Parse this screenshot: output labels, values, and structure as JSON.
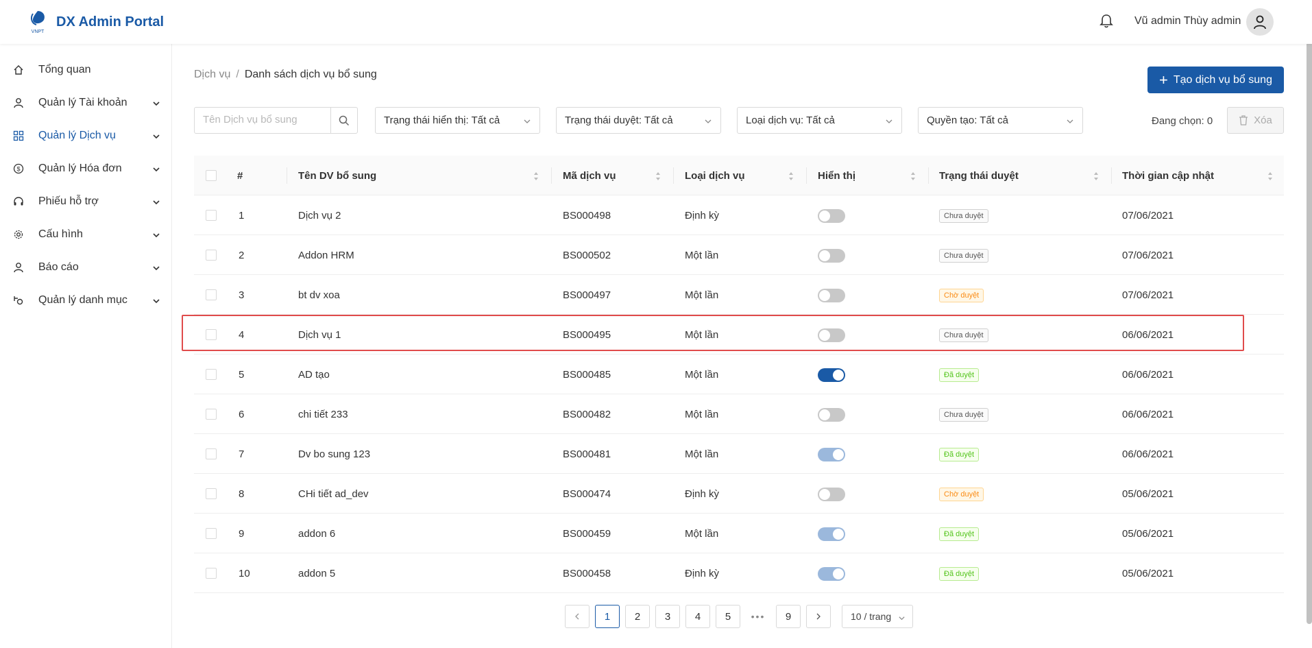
{
  "header": {
    "logo_text": "VNPT",
    "title": "DX Admin Portal",
    "username": "Vũ admin Thùy admin"
  },
  "sidebar": {
    "items": [
      {
        "label": "Tổng quan",
        "icon": "home-icon"
      },
      {
        "label": "Quản lý Tài khoản",
        "icon": "user-icon"
      },
      {
        "label": "Quản lý Dịch vụ",
        "icon": "grid-icon",
        "active": true
      },
      {
        "label": "Quản lý Hóa đơn",
        "icon": "dollar-icon"
      },
      {
        "label": "Phiếu hỗ trợ",
        "icon": "headset-icon"
      },
      {
        "label": "Cấu hình",
        "icon": "gear-icon"
      },
      {
        "label": "Báo cáo",
        "icon": "user-icon"
      },
      {
        "label": "Quản lý danh mục",
        "icon": "category-icon"
      }
    ]
  },
  "breadcrumb": {
    "parent": "Dịch vụ",
    "separator": "/",
    "current": "Danh sách dịch vụ bổ sung"
  },
  "toolbar": {
    "create_label": "Tạo dịch vụ bổ sung",
    "search_placeholder": "Tên Dịch vụ bổ sung",
    "filters": [
      "Trạng thái hiển thị: Tất cả",
      "Trạng thái duyệt: Tất cả",
      "Loại dịch vụ: Tất cả",
      "Quyền tạo: Tất cả"
    ],
    "selected_count": "Đang chọn: 0",
    "delete_label": "Xóa"
  },
  "table": {
    "columns": [
      "#",
      "Tên DV bổ sung",
      "Mã dịch vụ",
      "Loại dịch vụ",
      "Hiển thị",
      "Trạng thái duyệt",
      "Thời gian cập nhật"
    ],
    "rows": [
      {
        "no": "1",
        "name": "Dịch vụ 2",
        "code": "BS000498",
        "type": "Định kỳ",
        "display": "off",
        "status": "Chưa duyệt",
        "status_kind": "pending",
        "updated": "07/06/2021"
      },
      {
        "no": "2",
        "name": "Addon HRM",
        "code": "BS000502",
        "type": "Một lần",
        "display": "off",
        "status": "Chưa duyệt",
        "status_kind": "pending",
        "updated": "07/06/2021"
      },
      {
        "no": "3",
        "name": "bt dv xoa",
        "code": "BS000497",
        "type": "Một lần",
        "display": "off",
        "status": "Chờ duyệt",
        "status_kind": "waiting",
        "updated": "07/06/2021"
      },
      {
        "no": "4",
        "name": "Dịch vụ 1",
        "code": "BS000495",
        "type": "Một lần",
        "display": "off",
        "status": "Chưa duyệt",
        "status_kind": "pending",
        "updated": "06/06/2021"
      },
      {
        "no": "5",
        "name": "AD tạo",
        "code": "BS000485",
        "type": "Một lần",
        "display": "on",
        "status": "Đã duyệt",
        "status_kind": "approved",
        "updated": "06/06/2021"
      },
      {
        "no": "6",
        "name": "chi tiết 233",
        "code": "BS000482",
        "type": "Một lần",
        "display": "off",
        "status": "Chưa duyệt",
        "status_kind": "pending",
        "updated": "06/06/2021"
      },
      {
        "no": "7",
        "name": "Dv bo sung 123",
        "code": "BS000481",
        "type": "Một lần",
        "display": "on-disabled",
        "status": "Đã duyệt",
        "status_kind": "approved",
        "updated": "06/06/2021"
      },
      {
        "no": "8",
        "name": "CHi tiết ad_dev",
        "code": "BS000474",
        "type": "Định kỳ",
        "display": "off",
        "status": "Chờ duyệt",
        "status_kind": "waiting",
        "updated": "05/06/2021"
      },
      {
        "no": "9",
        "name": "addon 6",
        "code": "BS000459",
        "type": "Một lần",
        "display": "on-disabled",
        "status": "Đã duyệt",
        "status_kind": "approved",
        "updated": "05/06/2021"
      },
      {
        "no": "10",
        "name": "addon 5",
        "code": "BS000458",
        "type": "Định kỳ",
        "display": "on-disabled",
        "status": "Đã duyệt",
        "status_kind": "approved",
        "updated": "05/06/2021"
      }
    ]
  },
  "pagination": {
    "pages": [
      "1",
      "2",
      "3",
      "4",
      "5"
    ],
    "last_page": "9",
    "current_page": "1",
    "ellipsis": "•••",
    "page_size": "10 / trang"
  },
  "colors": {
    "primary": "#1a5aa6",
    "highlight": "#e04b4b"
  }
}
